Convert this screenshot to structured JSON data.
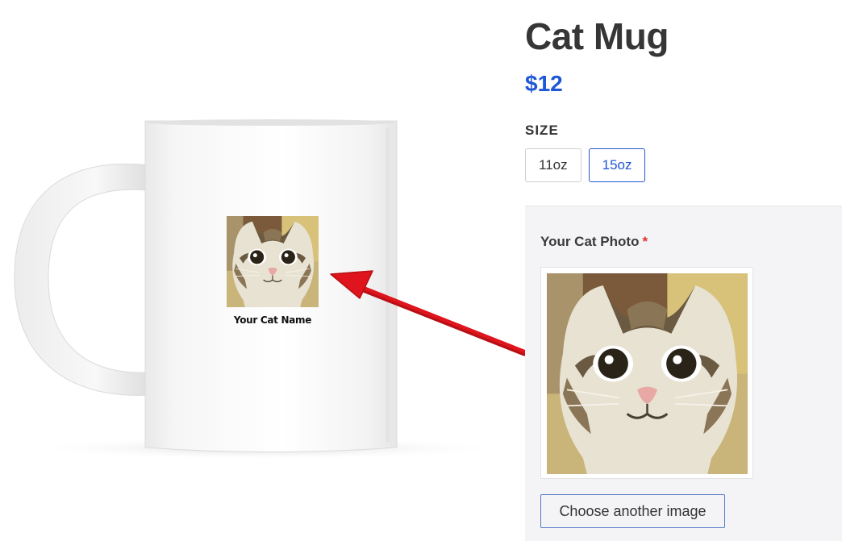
{
  "product": {
    "title": "Cat Mug",
    "price": "$12",
    "size_label": "SIZE",
    "sizes": [
      {
        "label": "11oz",
        "selected": false
      },
      {
        "label": "15oz",
        "selected": true
      }
    ]
  },
  "customization": {
    "photo_label": "Your Cat Photo",
    "required_marker": "*",
    "choose_button": "Choose another image"
  },
  "preview": {
    "mug_caption": "Your Cat Name"
  },
  "colors": {
    "accent": "#1f57d6",
    "required": "#e03131",
    "arrow": "#e0141c"
  },
  "icons": {
    "arrow": "arrow-pointing-to-mug-icon"
  }
}
